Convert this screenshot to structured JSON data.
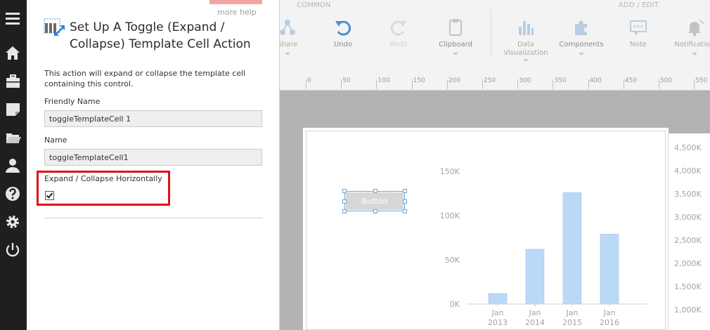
{
  "panel": {
    "more_help": "more help",
    "title": "Set Up A Toggle (Expand / Collapse) Template Cell Action",
    "description": "This action will expand or collapse the template cell containing this control.",
    "friendly_name_label": "Friendly Name",
    "friendly_name_value": "toggleTemplateCell 1",
    "name_label": "Name",
    "name_value": "toggleTemplateCell1",
    "expand_label": "Expand / Collapse Horizontally",
    "expand_checked": true
  },
  "ribbon": {
    "group_common": "COMMON",
    "group_add_edit": "ADD / EDIT",
    "share": "Share",
    "undo": "Undo",
    "redo": "Redo",
    "clipboard": "Clipboard",
    "data_visualization_1": "Data",
    "data_visualization_2": "Visualization",
    "components": "Components",
    "note": "Note",
    "notification": "Notification"
  },
  "ruler": {
    "ticks": [
      "0",
      "50",
      "100",
      "150",
      "200",
      "250",
      "300",
      "350",
      "400",
      "450",
      "500",
      "550"
    ]
  },
  "canvas": {
    "button_label": "Button"
  },
  "chart_data": [
    {
      "type": "bar",
      "categories": [
        "Jan 2013",
        "Jan 2014",
        "Jan 2015",
        "Jan 2016"
      ],
      "category_lines": [
        [
          "Jan",
          "2013"
        ],
        [
          "Jan",
          "2014"
        ],
        [
          "Jan",
          "2015"
        ],
        [
          "Jan",
          "2016"
        ]
      ],
      "values": [
        12000,
        62000,
        126000,
        79000
      ],
      "ylim": [
        0,
        150000
      ],
      "yticks": [
        0,
        50000,
        100000,
        150000
      ],
      "ytick_labels": [
        "0K",
        "50K",
        "100K",
        "150K"
      ],
      "grid": false,
      "color": "#bad9f7"
    },
    {
      "type": "bar",
      "ytick_labels": [
        "4,500K",
        "4,000K",
        "3,500K",
        "3,000K",
        "2,500K",
        "2,000K",
        "1,500K",
        "1,000K"
      ]
    }
  ]
}
